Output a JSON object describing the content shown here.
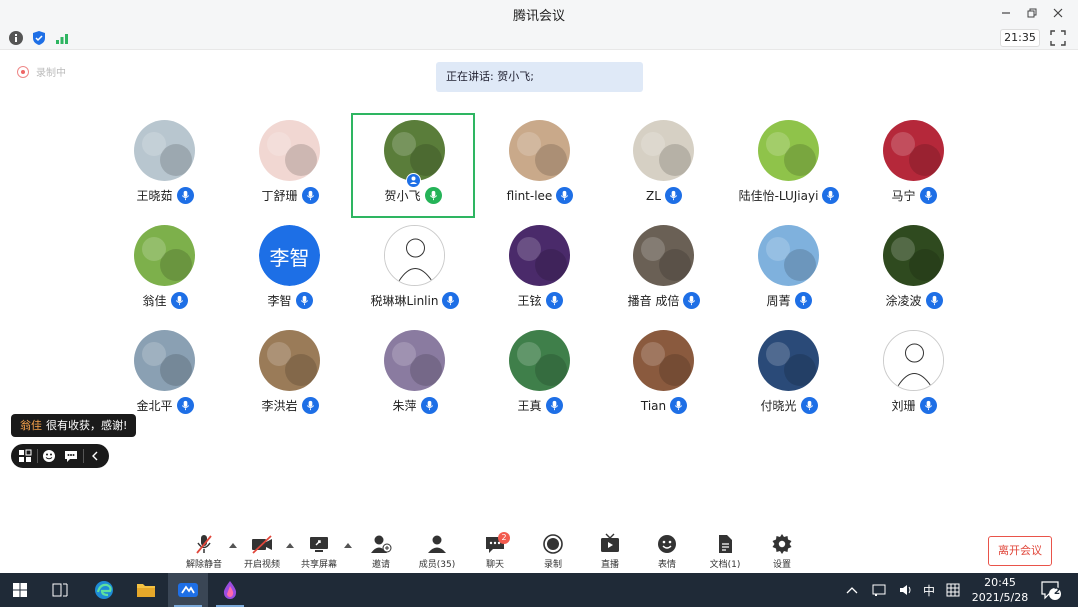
{
  "window": {
    "title": "腾讯会议",
    "top_time": "21:35"
  },
  "recording_label": "录制中",
  "speaking_banner": "正在讲话: 贺小飞;",
  "participants": [
    {
      "name": "王晓茹",
      "color": "#b8c6cf"
    },
    {
      "name": "丁舒珊",
      "color": "#f1d7d2"
    },
    {
      "name": "贺小飞",
      "color": "#5a7d3a",
      "speaking": true
    },
    {
      "name": "flint-lee",
      "color": "#c9a98a"
    },
    {
      "name": "ZL",
      "color": "#d6d0c4"
    },
    {
      "name": "陆佳怡-LUJiayi",
      "color": "#8fc34a"
    },
    {
      "name": "马宁",
      "color": "#b5283a"
    },
    {
      "name": "翁佳",
      "color": "#7db04b"
    },
    {
      "name": "李智",
      "color": "#1d6fe6",
      "initials": "李智"
    },
    {
      "name": "税琳琳Linlin",
      "color": "#ffffff"
    },
    {
      "name": "王铉",
      "color": "#4a2a6a"
    },
    {
      "name": "播音 成倍",
      "color": "#6a6055"
    },
    {
      "name": "周菁",
      "color": "#7fb1dd"
    },
    {
      "name": "涂凌波",
      "color": "#2f4a1f"
    },
    {
      "name": "金北平",
      "color": "#8aa0b3"
    },
    {
      "name": "李洪岩",
      "color": "#9a7b58"
    },
    {
      "name": "朱萍",
      "color": "#8a7ba0"
    },
    {
      "name": "王真",
      "color": "#3f7f4a"
    },
    {
      "name": "Tian",
      "color": "#8a5a3e"
    },
    {
      "name": "付晓光",
      "color": "#2a4a78"
    },
    {
      "name": "刘珊",
      "color": "#ffffff"
    }
  ],
  "chat_popup": {
    "sender": "翁佳",
    "message": "很有收获，感谢!"
  },
  "bottom_toolbar": {
    "mute": "解除静音",
    "video": "开启视频",
    "share": "共享屏幕",
    "invite": "邀请",
    "members": "成员(35)",
    "chat": "聊天",
    "chat_unread": "2",
    "record": "录制",
    "live": "直播",
    "reactions": "表情",
    "docs": "文档(1)",
    "settings": "设置",
    "leave": "离开会议"
  },
  "taskbar": {
    "ime": "中",
    "time": "20:45",
    "date": "2021/5/28",
    "notifications": "2"
  }
}
